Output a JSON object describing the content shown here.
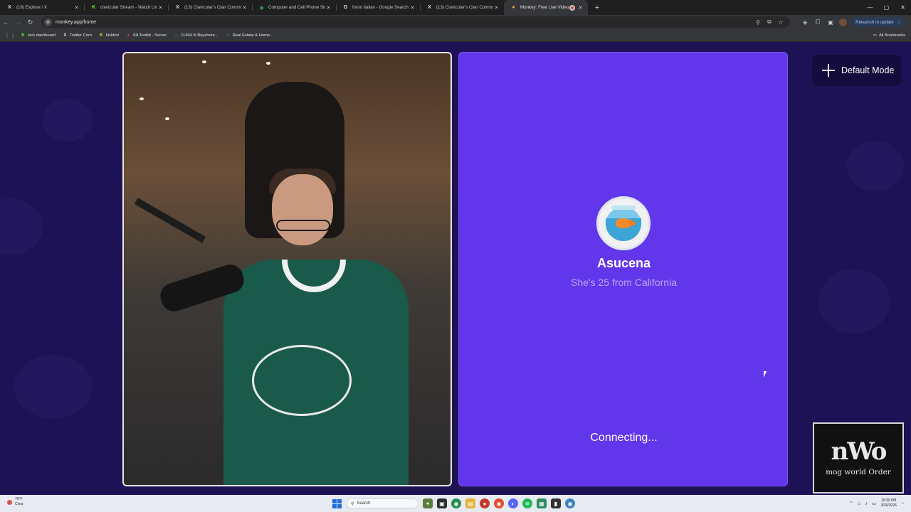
{
  "browser": {
    "tabs": [
      {
        "title": "(18) Explore / X",
        "icon": "x-logo-icon",
        "fav": "X",
        "fav_color": "#e3e3e3"
      },
      {
        "title": "clavicular Stream - Watch Live o",
        "icon": "kick-logo-icon",
        "fav": "K",
        "fav_color": "#53fc18"
      },
      {
        "title": "(13) Clavicular's Clan Communit",
        "icon": "x-logo-icon",
        "fav": "X",
        "fav_color": "#e3e3e3"
      },
      {
        "title": "Computer and Cell Phone Store",
        "icon": "maps-pin-icon",
        "fav": "◉",
        "fav_color": "#34a853"
      },
      {
        "title": "forno italian - Google Search",
        "icon": "google-logo-icon",
        "fav": "G",
        "fav_color": "#e3e3e3"
      },
      {
        "title": "(13) Clavicular's Clan Communit",
        "icon": "x-logo-icon",
        "fav": "X",
        "fav_color": "#e3e3e3"
      },
      {
        "title": "Monkey: Free Live Video Ch",
        "icon": "monkey-logo-icon",
        "fav": "●",
        "fav_color": "#f0b23a",
        "active": true
      }
    ],
    "url": "monkey.app/home",
    "relaunch_label": "Relaunch to update",
    "bookmarks": [
      {
        "label": "kick dashboard",
        "fav": "K",
        "color": "#53fc18"
      },
      {
        "label": "Twitter Com",
        "fav": "X",
        "color": "#e3e3e3"
      },
      {
        "label": "kickbot",
        "fav": "K",
        "color": "#f4d03f"
      },
      {
        "label": "IRLToolkit - Server",
        "fav": "●",
        "color": "#e0413b"
      },
      {
        "label": "11404 N Bayshore...",
        "fav": "⌂",
        "color": "#4a90e2"
      },
      {
        "label": "Real Estate & Home...",
        "fav": "⌂",
        "color": "#4a90e2"
      }
    ],
    "all_bookmarks_label": "All Bookmarks"
  },
  "page": {
    "mode_button_label": "Default Mode",
    "stranger": {
      "name": "Asucena",
      "info": "She's 25 from California",
      "status": "Connecting..."
    },
    "watermark": {
      "logo": "nWo",
      "text": "mog world Order"
    }
  },
  "taskbar": {
    "weather_temp": "76°F",
    "weather_desc": "Clear",
    "search_placeholder": "Search",
    "time": "10:30 PM",
    "date": "3/26/2026"
  },
  "colors": {
    "page_bg": "#1d1256",
    "stranger_panel": "#6236ea",
    "accent_text": "#b9aaf5"
  }
}
